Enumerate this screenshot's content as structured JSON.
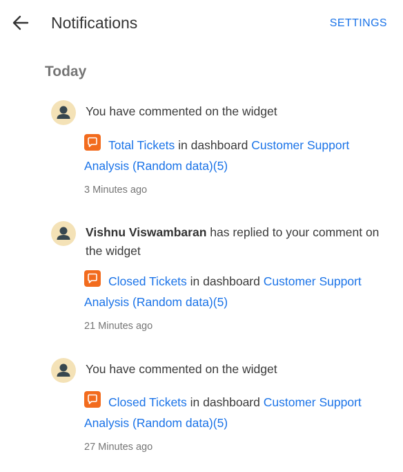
{
  "header": {
    "title": "Notifications",
    "settings_label": "SETTINGS"
  },
  "section": {
    "title": "Today"
  },
  "colors": {
    "accent": "#1a73e8",
    "chat_icon": "#f26b1d",
    "avatar_bg": "#f4e2b7",
    "avatar_figure": "#37474f"
  },
  "notifications": [
    {
      "user": "",
      "message": "You have commented on the widget",
      "widget": "Total Tickets",
      "connector": "in dashboard",
      "dashboard": "Customer Support Analysis (Random data)(5)",
      "time": "3 Minutes ago"
    },
    {
      "user": "Vishnu Viswambaran",
      "message": "has replied to your comment on the widget",
      "widget": "Closed Tickets",
      "connector": "in dashboard",
      "dashboard": "Customer Support Analysis (Random data)(5)",
      "time": "21 Minutes ago"
    },
    {
      "user": "",
      "message": "You have commented on the widget",
      "widget": "Closed Tickets",
      "connector": "in dashboard",
      "dashboard": "Customer Support Analysis (Random data)(5)",
      "time": "27 Minutes ago"
    }
  ]
}
